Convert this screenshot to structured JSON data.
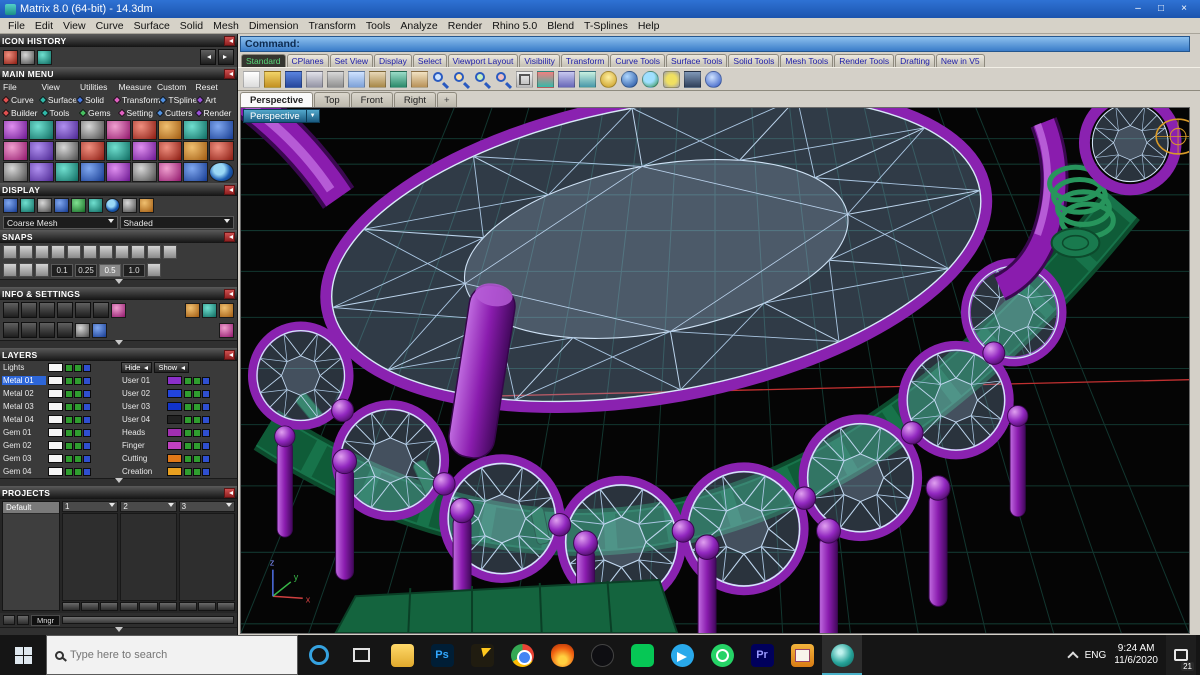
{
  "window": {
    "title": "Matrix 8.0 (64-bit) - 14.3dm"
  },
  "menu": {
    "items": [
      "File",
      "Edit",
      "View",
      "Curve",
      "Surface",
      "Solid",
      "Mesh",
      "Dimension",
      "Transform",
      "Tools",
      "Analyze",
      "Render",
      "Rhino 5.0",
      "Blend",
      "T-Splines",
      "Help"
    ]
  },
  "command_bar": {
    "label": "Command:"
  },
  "toolbar_tabs": [
    "Standard",
    "CPlanes",
    "Set View",
    "Display",
    "Select",
    "Viewport Layout",
    "Visibility",
    "Transform",
    "Curve Tools",
    "Surface Tools",
    "Solid Tools",
    "Mesh Tools",
    "Render Tools",
    "Drafting",
    "New in V5"
  ],
  "viewport": {
    "tabs": [
      "Perspective",
      "Top",
      "Front",
      "Right"
    ],
    "active_view_label": "Perspective",
    "axis": {
      "x": "x",
      "y": "y",
      "z": "z"
    }
  },
  "sidebar": {
    "icon_history": {
      "title": "ICON HISTORY"
    },
    "main_menu": {
      "title": "MAIN MENU",
      "row1": [
        "File",
        "View",
        "Utilities",
        "Measure",
        "Custom",
        "Reset"
      ],
      "row2": [
        {
          "label": "Curve",
          "color": "#e05050"
        },
        {
          "label": "Surface",
          "color": "#30b8a8"
        },
        {
          "label": "Solid",
          "color": "#4878e0"
        },
        {
          "label": "Transform",
          "color": "#e060c0"
        },
        {
          "label": "TSpline",
          "color": "#5090e0"
        },
        {
          "label": "Art",
          "color": "#9850d8"
        }
      ],
      "row3": [
        {
          "label": "Builder",
          "color": "#e05050"
        },
        {
          "label": "Tools",
          "color": "#30b8a8"
        },
        {
          "label": "Gems",
          "color": "#48c060"
        },
        {
          "label": "Setting",
          "color": "#e060c0"
        },
        {
          "label": "Cutters",
          "color": "#5090e0"
        },
        {
          "label": "Render",
          "color": "#9850d8"
        }
      ]
    },
    "display": {
      "title": "DISPLAY",
      "mesh_mode": "Coarse Mesh",
      "shade_mode": "Shaded"
    },
    "snaps": {
      "title": "SNAPS",
      "grid_values": [
        "0.1",
        "0.25",
        "0.5",
        "1.0"
      ],
      "active_value": "0.5"
    },
    "info_settings": {
      "title": "INFO & SETTINGS"
    },
    "layers": {
      "title": "LAYERS",
      "lights": {
        "name": "Lights",
        "color": "#f5f5f5"
      },
      "hide_label": "Hide",
      "show_label": "Show",
      "left": [
        {
          "name": "Metal 01",
          "color": "#f5f5f5"
        },
        {
          "name": "Metal 02",
          "color": "#f5f5f5"
        },
        {
          "name": "Metal 03",
          "color": "#f5f5f5"
        },
        {
          "name": "Metal 04",
          "color": "#f5f5f5"
        },
        {
          "name": "Gem 01",
          "color": "#f5f5f5"
        },
        {
          "name": "Gem 02",
          "color": "#f5f5f5"
        },
        {
          "name": "Gem 03",
          "color": "#f5f5f5"
        },
        {
          "name": "Gem 04",
          "color": "#f5f5f5"
        }
      ],
      "right": [
        {
          "name": "User 01",
          "color": "#8b2fc9"
        },
        {
          "name": "User 02",
          "color": "#2244dd"
        },
        {
          "name": "User 03",
          "color": "#1133cc"
        },
        {
          "name": "User 04",
          "color": "#222222"
        },
        {
          "name": "Heads",
          "color": "#a02fb0"
        },
        {
          "name": "Finger",
          "color": "#c040c0"
        },
        {
          "name": "Cutting",
          "color": "#e07818"
        },
        {
          "name": "Creation",
          "color": "#e8a020"
        }
      ]
    },
    "projects": {
      "title": "PROJECTS",
      "list": [
        "Default"
      ],
      "slots": [
        "1",
        "2",
        "3"
      ],
      "manager_label": "Mngr"
    }
  },
  "taskbar": {
    "search_placeholder": "Type here to search",
    "language": "ENG",
    "time": "9:24 AM",
    "date": "11/6/2020",
    "notification_count": "21"
  },
  "icons": {
    "minimize": "–",
    "maximize": "□",
    "close": "×",
    "dropdown": "▼",
    "photoshop": "Ps",
    "premiere": "Pr"
  },
  "colors": {
    "accent_titlebar": "#2a68c8",
    "viewport_bg": "#050505",
    "metal_purple": "#8a1cae",
    "metal_green": "#17734a",
    "gem_wire": "#d4e6f8",
    "grid": "#143c34"
  }
}
